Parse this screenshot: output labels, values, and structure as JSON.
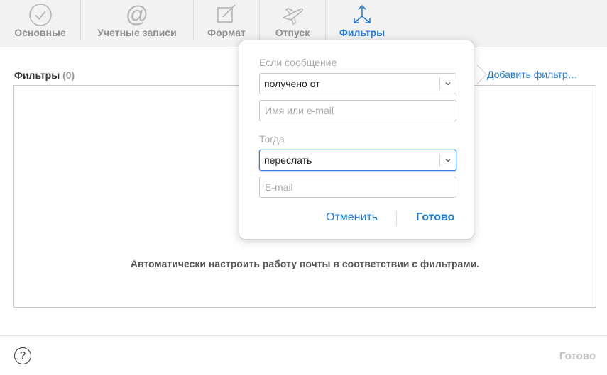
{
  "toolbar": {
    "tabs": [
      {
        "label": "Основные",
        "icon": "checkmark-circle-icon"
      },
      {
        "label": "Учетные записи",
        "icon": "at-sign-icon"
      },
      {
        "label": "Формат",
        "icon": "compose-icon"
      },
      {
        "label": "Отпуск",
        "icon": "airplane-icon"
      },
      {
        "label": "Фильтры",
        "icon": "arrows-icon",
        "active": true
      }
    ]
  },
  "main": {
    "filters_title": "Фильтры",
    "filters_count": "(0)",
    "add_filter": "Добавить фильтр…",
    "empty_message": "Автоматически настроить работу почты в соответствии с фильтрами."
  },
  "popover": {
    "if_label": "Если сообщение",
    "condition_value": "получено от",
    "condition_placeholder": "Имя или e-mail",
    "then_label": "Тогда",
    "action_value": "переслать",
    "action_placeholder": "E-mail",
    "cancel": "Отменить",
    "done": "Готово"
  },
  "footer": {
    "help": "?",
    "done": "Готово"
  },
  "colors": {
    "accent": "#1f7ae0",
    "toolbar_bg": "#f2f2f2",
    "inactive_text": "#8e8e8e",
    "disabled_text": "#c4c4c4"
  }
}
